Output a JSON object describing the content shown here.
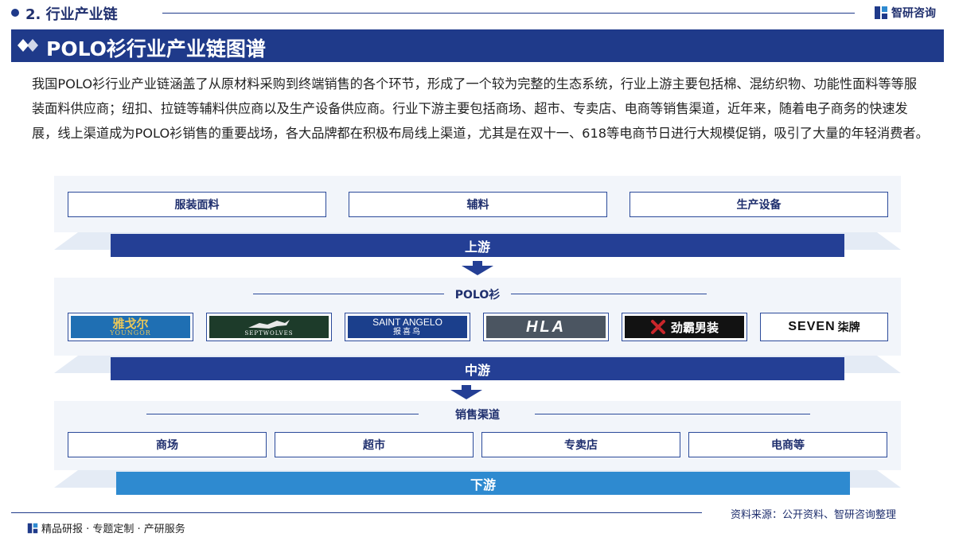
{
  "header": {
    "section_title": "2. 行业产业链",
    "brand_name": "智研咨询"
  },
  "banner": {
    "title": "POLO衫行业产业链图谱"
  },
  "intro": "我国POLO衫行业产业链涵盖了从原材料采购到终端销售的各个环节，形成了一个较为完整的生态系统，行业上游主要包括棉、混纺织物、功能性面料等等服装面料供应商；纽扣、拉链等辅料供应商以及生产设备供应商。行业下游主要包括商场、超市、专卖店、电商等销售渠道，近年来，随着电子商务的快速发展，线上渠道成为POLO衫销售的重要战场，各大品牌都在积极布局线上渠道，尤其是在双十一、618等电商节日进行大规模促销，吸引了大量的年轻消费者。",
  "upstream": {
    "items": [
      "服装面料",
      "辅料",
      "生产设备"
    ],
    "tier_label": "上游"
  },
  "midstream": {
    "heading": "POLO衫",
    "logos": [
      {
        "cn": "雅戈尔",
        "en": "YOUNGOR",
        "bg": "#1f6fb3",
        "fg": "#e8c65a"
      },
      {
        "cn": "",
        "en": "SEPTWOLVES",
        "bg": "#1d3b2a",
        "fg": "#ffffff"
      },
      {
        "cn": "报喜鸟",
        "en": "SAINT ANGELO",
        "bg": "#1b3f8c",
        "fg": "#ffffff"
      },
      {
        "cn": "",
        "en": "HLA",
        "bg": "#4b5561",
        "fg": "#ffffff"
      },
      {
        "cn": "劲霸男装",
        "en": "",
        "bg": "#121212",
        "fg": "#ffffff"
      },
      {
        "cn": "柒牌",
        "en": "SEVEN",
        "bg": "#ffffff",
        "fg": "#111111"
      }
    ],
    "tier_label": "中游"
  },
  "downstream": {
    "heading": "销售渠道",
    "items": [
      "商场",
      "超市",
      "专卖店",
      "电商等"
    ],
    "tier_label": "下游"
  },
  "footer": {
    "left": "精品研报 · 专题定制 · 产研服务",
    "right": "资料来源：公开资料、智研咨询整理"
  },
  "colors": {
    "primary": "#1f3a8a",
    "tier_dark": "#243f95",
    "tier_light": "#2e8ad0",
    "panel_bg": "#f2f5fa"
  }
}
